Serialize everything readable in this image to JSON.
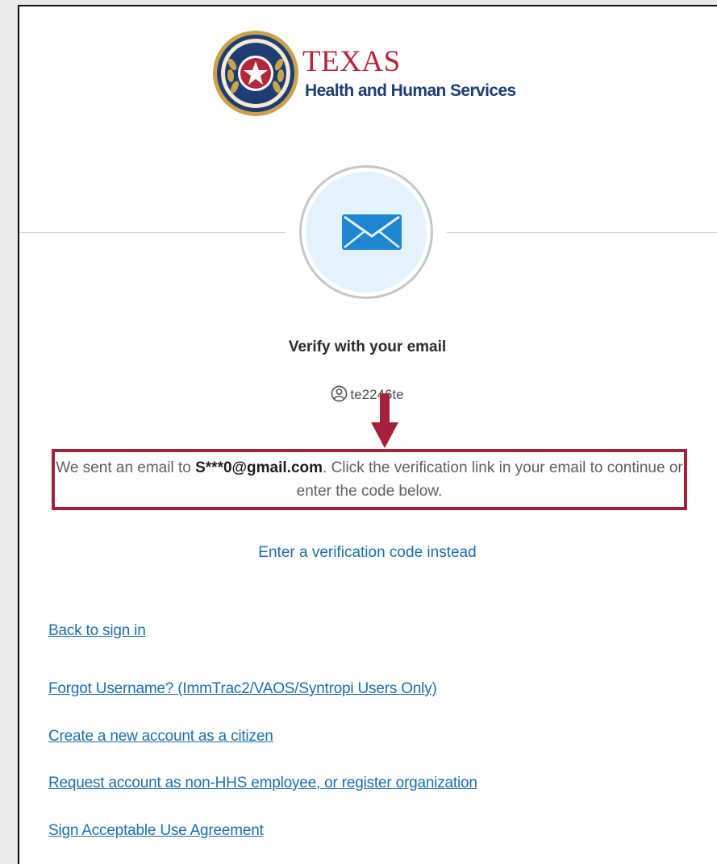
{
  "logo": {
    "title": "TEXAS",
    "subtitle": "Health and Human Services",
    "colors": {
      "red": "#b3273a",
      "navy": "#1f3d73",
      "gold": "#c9a24a"
    }
  },
  "factor_icon": "envelope-icon",
  "heading": "Verify with your email",
  "username": "te2246te",
  "message": {
    "prefix": "We sent an email to ",
    "email": "S***0@gmail.com",
    "suffix": ". Click the verification link in your email to continue or enter the code below."
  },
  "code_link": "Enter a verification code instead",
  "links": [
    "Back to sign in",
    "Forgot Username? (ImmTrac2/VAOS/Syntropi Users Only)",
    "Create a new account as a citizen",
    "Request account as non-HHS employee, or register organization",
    "Sign Acceptable Use Agreement"
  ],
  "annotation_color": "#a3213a",
  "link_color": "#1a6fae"
}
